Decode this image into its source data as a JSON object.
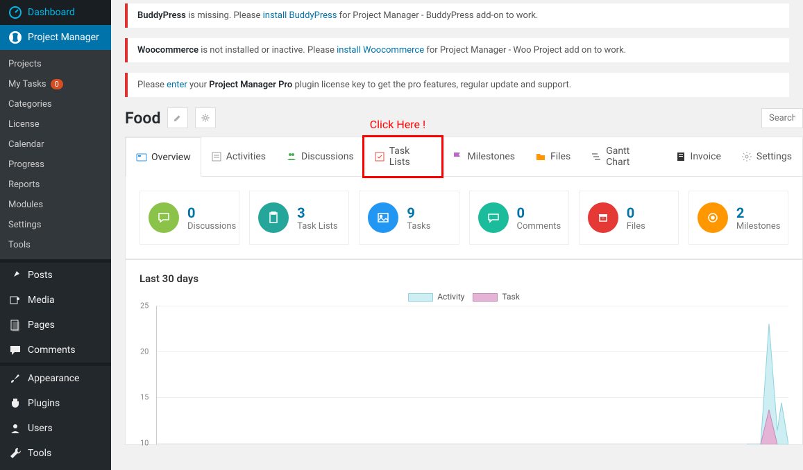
{
  "sidebar": {
    "top": [
      {
        "label": "Dashboard",
        "icon": "dashboard"
      },
      {
        "label": "Project Manager",
        "icon": "pm",
        "active": true
      }
    ],
    "subs": [
      {
        "label": "Projects"
      },
      {
        "label": "My Tasks",
        "badge": "0"
      },
      {
        "label": "Categories"
      },
      {
        "label": "License"
      },
      {
        "label": "Calendar"
      },
      {
        "label": "Progress"
      },
      {
        "label": "Reports"
      },
      {
        "label": "Modules"
      },
      {
        "label": "Settings"
      },
      {
        "label": "Tools"
      }
    ],
    "bottom": [
      {
        "label": "Posts",
        "icon": "pin"
      },
      {
        "label": "Media",
        "icon": "media"
      },
      {
        "label": "Pages",
        "icon": "pages"
      },
      {
        "label": "Comments",
        "icon": "comments"
      },
      {
        "label": "Appearance",
        "icon": "brush"
      },
      {
        "label": "Plugins",
        "icon": "plug"
      },
      {
        "label": "Users",
        "icon": "users"
      },
      {
        "label": "Tools",
        "icon": "wrench"
      }
    ]
  },
  "notices": [
    {
      "pre": "",
      "strong": "BuddyPress",
      "mid": " is missing. Please ",
      "link": "install BuddyPress",
      "post": " for Project Manager - BuddyPress add-on to work."
    },
    {
      "pre": "",
      "strong": "Woocommerce",
      "mid": " is not installed or inactive. Please ",
      "link": "install Woocommerce",
      "post": " for Project Manager - Woo Project add on to work."
    },
    {
      "pre": "Please ",
      "link2": "enter",
      "mid2": " your ",
      "strong2": "Project Manager Pro",
      "post2": " plugin license key to get the pro features, regular update and support."
    }
  ],
  "page": {
    "title": "Food",
    "searchPlaceholder": "Search ..."
  },
  "annotation": {
    "clickHere": "Click Here !"
  },
  "tabs": [
    {
      "label": "Overview",
      "icon": "overview",
      "color": "#2196f3",
      "active": true
    },
    {
      "label": "Activities",
      "icon": "activities",
      "color": "#9e9e9e"
    },
    {
      "label": "Discussions",
      "icon": "discussions",
      "color": "#4caf50"
    },
    {
      "label": "Task Lists",
      "icon": "tasklists",
      "color": "#e74c3c",
      "highlight": true
    },
    {
      "label": "Milestones",
      "icon": "flag",
      "color": "#ba68c8"
    },
    {
      "label": "Files",
      "icon": "folder",
      "color": "#ff9800"
    },
    {
      "label": "Gantt Chart",
      "icon": "gantt",
      "color": "#9e9e9e"
    },
    {
      "label": "Invoice",
      "icon": "invoice",
      "color": "#333"
    },
    {
      "label": "Settings",
      "icon": "gear",
      "color": "#9e9e9e"
    }
  ],
  "stats": [
    {
      "count": "0",
      "label": "Discussions",
      "color": "c-green",
      "icon": "chat"
    },
    {
      "count": "3",
      "label": "Task Lists",
      "color": "c-teal",
      "icon": "clipboard"
    },
    {
      "count": "9",
      "label": "Tasks",
      "color": "c-blue",
      "icon": "image"
    },
    {
      "count": "0",
      "label": "Comments",
      "color": "c-cyan",
      "icon": "comment"
    },
    {
      "count": "0",
      "label": "Files",
      "color": "c-red",
      "icon": "archive"
    },
    {
      "count": "2",
      "label": "Milestones",
      "color": "c-orange",
      "icon": "target"
    }
  ],
  "chart": {
    "title": "Last 30 days",
    "legend": [
      "Activity",
      "Task"
    ]
  },
  "chart_data": {
    "type": "area",
    "title": "Last 30 days",
    "ylabel": "",
    "ylim": [
      0,
      26
    ],
    "yticks": [
      10,
      15,
      20,
      25
    ],
    "series": [
      {
        "name": "Activity",
        "color": "#cdeef3"
      },
      {
        "name": "Task",
        "color": "#e5b3d6"
      }
    ],
    "note": "Chart shows a spike near the rightmost days reaching ~23 for Activity series; most other values not visible in crop."
  }
}
